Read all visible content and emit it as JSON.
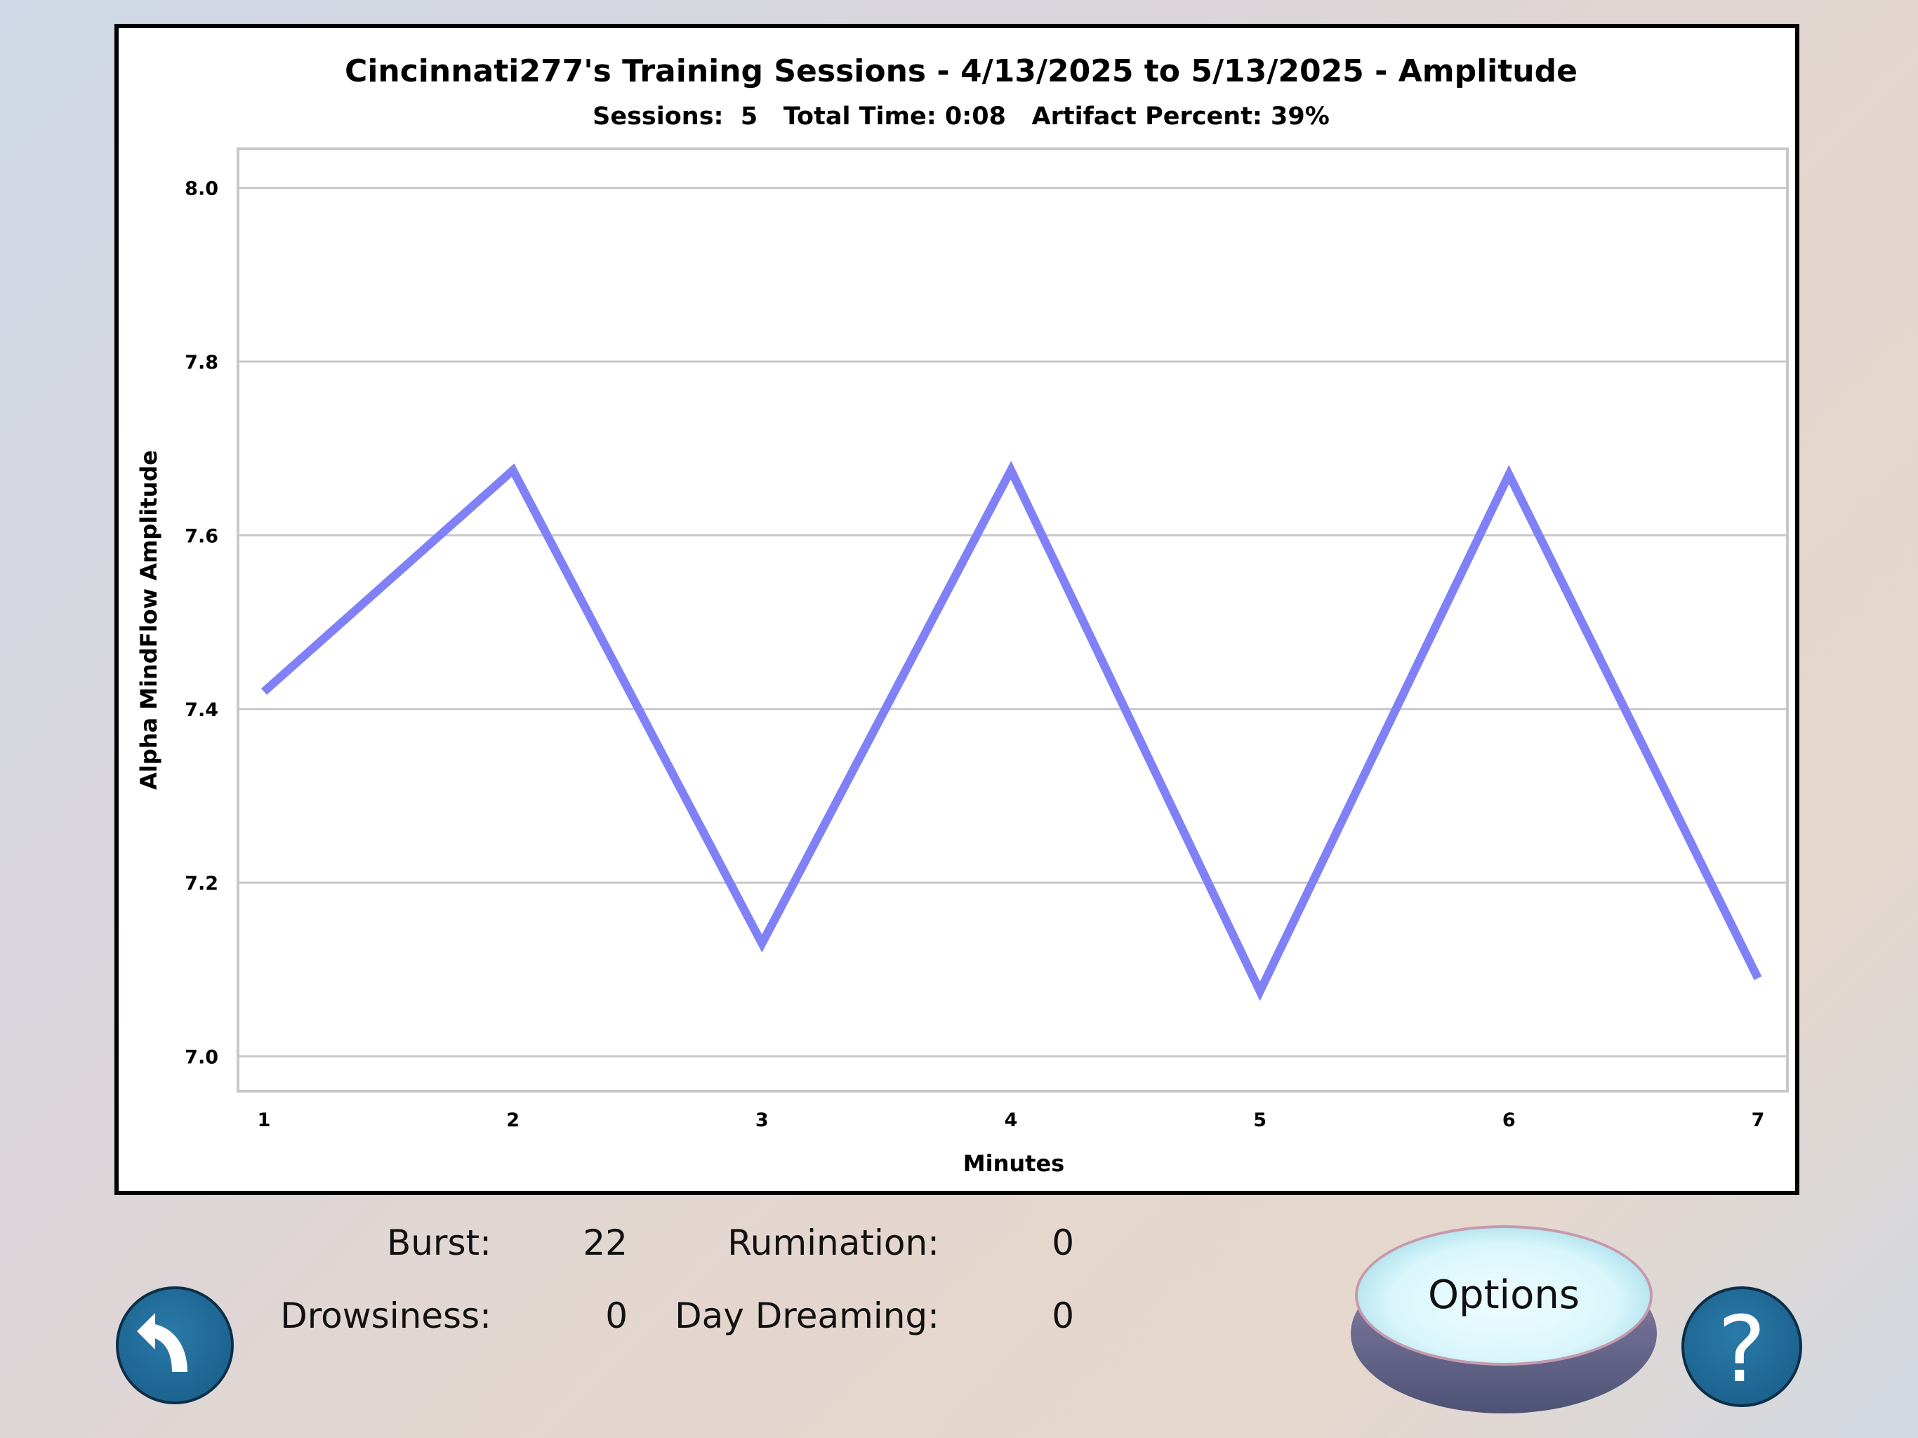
{
  "chart_data": {
    "type": "line",
    "title": "Cincinnati277's Training Sessions - 4/13/2025 to 5/13/2025 - Amplitude",
    "subtitle": "Sessions:  5   Total Time: 0:08   Artifact Percent: 39%",
    "xlabel": "Minutes",
    "ylabel": "Alpha MindFlow Amplitude",
    "x": [
      1,
      2,
      3,
      4,
      5,
      6,
      7
    ],
    "x_tick_labels": [
      "1",
      "2",
      "3",
      "4",
      "5",
      "6",
      "7"
    ],
    "series": [
      {
        "values": [
          7.42,
          7.675,
          7.13,
          7.675,
          7.075,
          7.67,
          7.09
        ],
        "color": "#8080f8"
      }
    ],
    "ylim": [
      6.96,
      8.045
    ],
    "y_ticks": [
      7.0,
      7.2,
      7.4,
      7.6,
      7.8,
      8.0
    ],
    "y_tick_labels": [
      "7.0",
      "7.2",
      "7.4",
      "7.6",
      "7.8",
      "8.0"
    ],
    "grid": true,
    "grid_axis": "y",
    "legend": "none"
  },
  "stats": {
    "burst_label": "Burst:",
    "burst_value": "22",
    "rumination_label": "Rumination:",
    "rumination_value": "0",
    "drowsiness_label": "Drowsiness:",
    "drowsiness_value": "0",
    "daydreaming_label": "Day Dreaming:",
    "daydreaming_value": "0"
  },
  "buttons": {
    "options_label": "Options",
    "help_label": "?",
    "back_icon": "back-arrow-icon"
  },
  "colors": {
    "button_blue": "#1f6794",
    "line": "#8080f8",
    "grid": "#c8c8c8"
  }
}
